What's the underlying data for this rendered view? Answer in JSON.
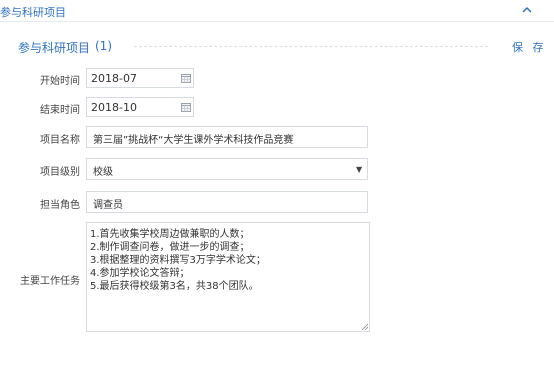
{
  "panel": {
    "title": "参与科研项目"
  },
  "section": {
    "title": "参与科研项目",
    "count": "(1)",
    "save_label": "保 存"
  },
  "fields": {
    "start_time": {
      "label": "开始时间",
      "value": "2018-07"
    },
    "end_time": {
      "label": "结束时间",
      "value": "2018-10"
    },
    "project_name": {
      "label": "项目名称",
      "value": "第三届”挑战杯“大学生课外学术科技作品竞赛"
    },
    "project_level": {
      "label": "项目级别",
      "value": "校级"
    },
    "role": {
      "label": "担当角色",
      "value": "调查员"
    },
    "main_tasks": {
      "label": "主要工作任务",
      "lines": [
        "1.首先收集学校周边做兼职的人数；",
        "2.制作调查问卷，做进一步的调查；",
        "3.根据整理的资料撰写3万字学术论文；",
        "4.参加学校论文答辩；",
        "5.最后获得校级第3名，共38个团队。"
      ]
    }
  },
  "icons": {
    "collapse": "chevron-up-icon",
    "calendar": "calendar-icon",
    "dropdown": "dropdown-arrow-icon",
    "resize": "resize-handle-icon"
  },
  "colors": {
    "accent": "#2f72c4",
    "border": "#d6dbe2",
    "text": "#333333"
  }
}
